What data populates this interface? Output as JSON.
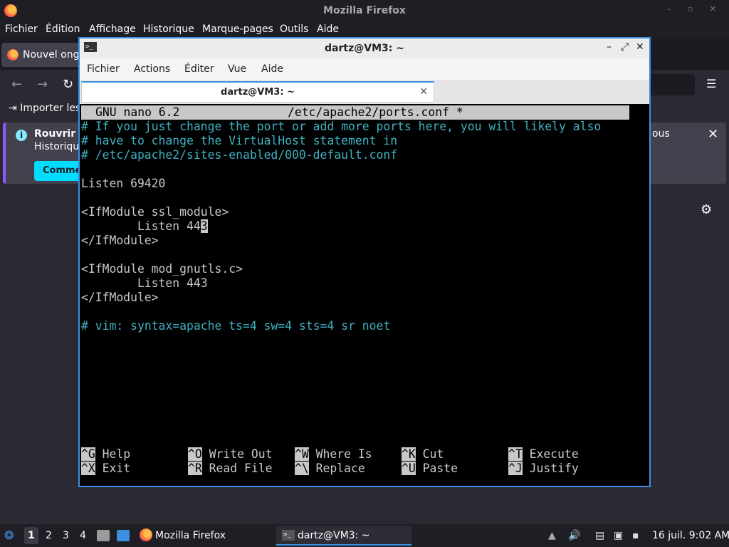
{
  "firefox": {
    "title": "Mozilla Firefox",
    "menu": [
      "Fichier",
      "Édition",
      "Affichage",
      "Historique",
      "Marque-pages",
      "Outils",
      "Aide"
    ],
    "tab_label": "Nouvel ongl",
    "bookmark_import": "Importer les",
    "infobar": {
      "title": "Rouvrir le",
      "subtitle": "Historique",
      "right_text": "ous",
      "button": "Commen"
    }
  },
  "terminal": {
    "title": "dartz@VM3: ~",
    "menu": [
      "Fichier",
      "Actions",
      "Éditer",
      "Vue",
      "Aide"
    ],
    "tab_label": "dartz@VM3: ~"
  },
  "nano": {
    "version": "GNU nano 6.2",
    "file": "/etc/apache2/ports.conf *",
    "lines": [
      "# If you just change the port or add more ports here, you will likely also",
      "# have to change the VirtualHost statement in",
      "# /etc/apache2/sites-enabled/000-default.conf",
      "",
      "Listen 69420",
      "",
      "<IfModule ssl_module>",
      "        Listen 44",
      "</IfModule>",
      "",
      "<IfModule mod_gnutls.c>",
      "        Listen 443",
      "</IfModule>",
      "",
      "# vim: syntax=apache ts=4 sw=4 sts=4 sr noet"
    ],
    "cursor_char": "3",
    "shortcuts": [
      [
        {
          "key": "^G",
          "label": "Help"
        },
        {
          "key": "^O",
          "label": "Write Out"
        },
        {
          "key": "^W",
          "label": "Where Is"
        },
        {
          "key": "^K",
          "label": "Cut"
        },
        {
          "key": "^T",
          "label": "Execute"
        }
      ],
      [
        {
          "key": "^X",
          "label": "Exit"
        },
        {
          "key": "^R",
          "label": "Read File"
        },
        {
          "key": "^\\",
          "label": "Replace"
        },
        {
          "key": "^U",
          "label": "Paste"
        },
        {
          "key": "^J",
          "label": "Justify"
        }
      ]
    ]
  },
  "taskbar": {
    "workspaces": [
      "1",
      "2",
      "3",
      "4"
    ],
    "firefox_task": "Mozilla Firefox",
    "terminal_task": "dartz@VM3: ~",
    "clock": "16 juil. 9:02 AM"
  },
  "colors": {
    "terminal_border": "#3d8fe0",
    "comment": "#40b0c0",
    "infobar_button": "#00ddff"
  }
}
